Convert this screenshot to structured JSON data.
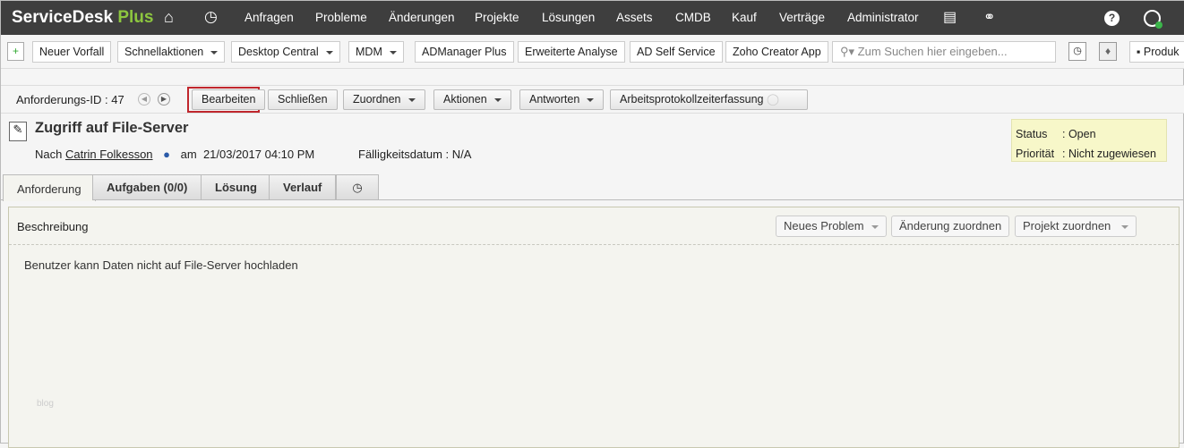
{
  "header": {
    "logo_main": "ServiceDesk",
    "logo_accent": "Plus",
    "nav": [
      "Anfragen",
      "Probleme",
      "Änderungen",
      "Projekte",
      "Lösungen",
      "Assets",
      "CMDB",
      "Kauf",
      "Verträge",
      "Administrator"
    ]
  },
  "toolbar": {
    "buttons": [
      "Neuer Vorfall",
      "Schnellaktionen",
      "Desktop Central",
      "MDM",
      "ADManager Plus",
      "Erweiterte Analyse",
      "AD Self Service",
      "Zoho Creator App"
    ],
    "search_placeholder": "Zum Suchen hier eingeben...",
    "product_label": "Produk"
  },
  "actions": {
    "request_id": "Anforderungs-ID : 47",
    "edit": "Bearbeiten",
    "close": "Schließen",
    "assign": "Zuordnen",
    "actions": "Aktionen",
    "reply": "Antworten",
    "worklog": "Arbeitsprotokollzeiterfassung"
  },
  "request": {
    "title": "Zugriff auf File-Server",
    "by_label": "Nach",
    "requester": "Catrin Folkesson",
    "on_label": "am",
    "date": "21/03/2017 04:10 PM",
    "due": "Fälligkeitsdatum : N/A",
    "status_label": "Status",
    "status_value": ": Open",
    "priority_label": "Priorität",
    "priority_value": ": Nicht zugewiesen"
  },
  "tabs": [
    "Anforderung",
    "Aufgaben (0/0)",
    "Lösung",
    "Verlauf"
  ],
  "panel": {
    "title": "Beschreibung",
    "new_problem": "Neues Problem",
    "assign_change": "Änderung zuordnen",
    "assign_project": "Projekt zuordnen",
    "description": "Benutzer kann Daten nicht auf File-Server hochladen",
    "watermark": "blog"
  }
}
